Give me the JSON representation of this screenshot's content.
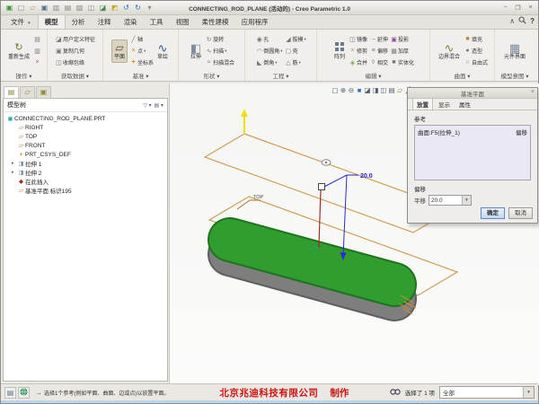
{
  "titlebar": {
    "title": "CONNECTING_ROD_PLANE (活动的) - Creo Parametric 1.0"
  },
  "tabs": {
    "file": "文件",
    "items": [
      "模型",
      "分析",
      "注释",
      "渲染",
      "工具",
      "视图",
      "柔性建模",
      "应用程序"
    ],
    "active": "模型"
  },
  "ribbon": {
    "regenerate": "重新生成",
    "udf": "用户定义特征",
    "copy_geometry": "复制几何",
    "shrinkwrap": "收缩包络",
    "plane": "平面",
    "axis": "轴",
    "point": "点",
    "csys": "坐标系",
    "sketch": "草绘",
    "extrude": "拉伸",
    "revolve": "旋转",
    "sweep": "扫描",
    "swept_blend": "扫描混合",
    "hole": "孔",
    "round": "倒圆角",
    "chamfer": "倒角",
    "draft": "拔模",
    "shell": "壳",
    "rib": "筋",
    "pattern": "阵列",
    "mirror": "镜像",
    "trim": "修剪",
    "merge": "合并",
    "extend": "延伸",
    "offset": "偏移",
    "intersect": "相交",
    "project": "投影",
    "thicken": "加厚",
    "solidify": "实体化",
    "boundary_blend": "边界混合",
    "fill": "填充",
    "style": "造型",
    "freestyle": "自由式",
    "component_interface": "元件界面",
    "groups": {
      "operations": "操作",
      "get_data": "获取数据",
      "datum": "基准",
      "shapes": "形状",
      "engineering": "工程",
      "editing": "编辑",
      "surfaces": "曲面",
      "model_intent": "模型意图"
    }
  },
  "graphics_toolbar": {
    "icons": [
      "refit",
      "zoom-in",
      "zoom-out",
      "repaint",
      "display-style",
      "saved-orientations",
      "view-manager",
      "section-view",
      "datum-display",
      "annotation-display"
    ]
  },
  "model_tree": {
    "header": "模型树",
    "items": [
      {
        "label": "CONNECTING_ROD_PLANE.PRT"
      },
      {
        "label": "RIGHT"
      },
      {
        "label": "TOP"
      },
      {
        "label": "FRONT"
      },
      {
        "label": "PRT_CSYS_DEF"
      },
      {
        "label": "拉伸 1"
      },
      {
        "label": "拉伸 2"
      },
      {
        "label": "在此插入"
      },
      {
        "label": "基准平面 标识195"
      }
    ]
  },
  "viewport": {
    "dimension_value": "20.0",
    "datum_tag": "TOP"
  },
  "dialog": {
    "title": "基准平面",
    "tab_placement": "放置",
    "tab_display": "显示",
    "tab_properties": "属性",
    "references_label": "参考",
    "reference_surface": "曲面:F5(拉伸_1)",
    "reference_constraint": "偏移",
    "offset_label": "偏移",
    "translation_label": "平移",
    "translation_value": "20.0",
    "ok_label": "确定",
    "cancel_label": "取消"
  },
  "status_bar": {
    "message": "选择1个参考(例如平面、曲面、边或点)以放置平面。",
    "brand": "北京兆迪科技有限公司",
    "brand_suffix": "制作",
    "selection_count": "选择了 1 项",
    "filter_value": "全部"
  },
  "colors": {
    "model_green": "#2f9e2f",
    "plane_preview_tan": "#cf9f56",
    "dimension_blue": "#2a2ad0",
    "leader_red": "#993324",
    "normal_arrow_yellow": "#ecdf0a",
    "selection_orange": "#e08a2e",
    "brand_red": "#cc1111"
  }
}
